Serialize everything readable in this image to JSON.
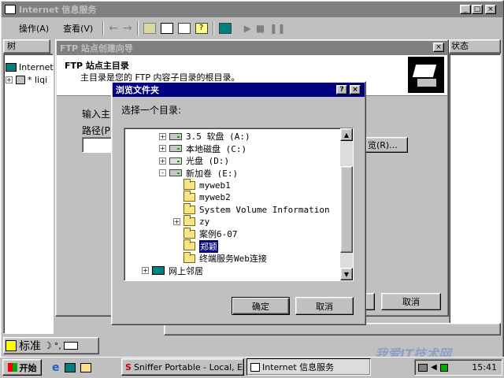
{
  "main_window": {
    "title": "Internet 信息服务",
    "menu": [
      "操作(A)",
      "查看(V)"
    ],
    "tree_header": "树",
    "tree_items": [
      "Internet",
      "* liqi"
    ],
    "status_header": "状态"
  },
  "wizard": {
    "title": "FTP 站点创建向导",
    "heading": "FTP 站点主目录",
    "subheading": "主目录是您的 FTP 内容子目录的根目录。",
    "input_label": "输入主",
    "path_label": "路径(P",
    "browse_label": "览(R)...",
    "cancel_label": "取消"
  },
  "browse_dialog": {
    "title": "浏览文件夹",
    "prompt": "选择一个目录:",
    "ok_label": "确定",
    "cancel_label": "取消",
    "help_label": "?",
    "close_label": "×",
    "tree": [
      {
        "label": "3.5 软盘 (A:)",
        "icon": "floppy-drive-icon",
        "expander": "+"
      },
      {
        "label": "本地磁盘 (C:)",
        "icon": "hard-drive-icon",
        "expander": "+"
      },
      {
        "label": "光盘 (D:)",
        "icon": "cd-drive-icon",
        "expander": "+"
      },
      {
        "label": "新加卷 (E:)",
        "icon": "hard-drive-icon",
        "expander": "-"
      },
      {
        "label": "myweb1",
        "icon": "folder-icon",
        "expander": ""
      },
      {
        "label": "myweb2",
        "icon": "folder-icon",
        "expander": ""
      },
      {
        "label": "System Volume Information",
        "icon": "folder-icon",
        "expander": ""
      },
      {
        "label": "zy",
        "icon": "folder-icon",
        "expander": "+"
      },
      {
        "label": "案例6-07",
        "icon": "folder-icon",
        "expander": ""
      },
      {
        "label": "郑颖",
        "icon": "folder-icon",
        "expander": "",
        "selected": true
      },
      {
        "label": "终端服务Web连接",
        "icon": "folder-icon",
        "expander": ""
      },
      {
        "label": "网上邻居",
        "icon": "network-icon",
        "expander": "+"
      }
    ]
  },
  "ime_bar": {
    "label": "标准"
  },
  "taskbar": {
    "start_label": "开始",
    "tasks": [
      "Sniffer Portable - Local, E...",
      "Internet 信息服务"
    ],
    "clock": "15:41"
  },
  "watermark": "我爱IT技术网",
  "colors": {
    "title_active": "#000080",
    "desktop": "#c0c0c0",
    "selection": "#000080"
  }
}
